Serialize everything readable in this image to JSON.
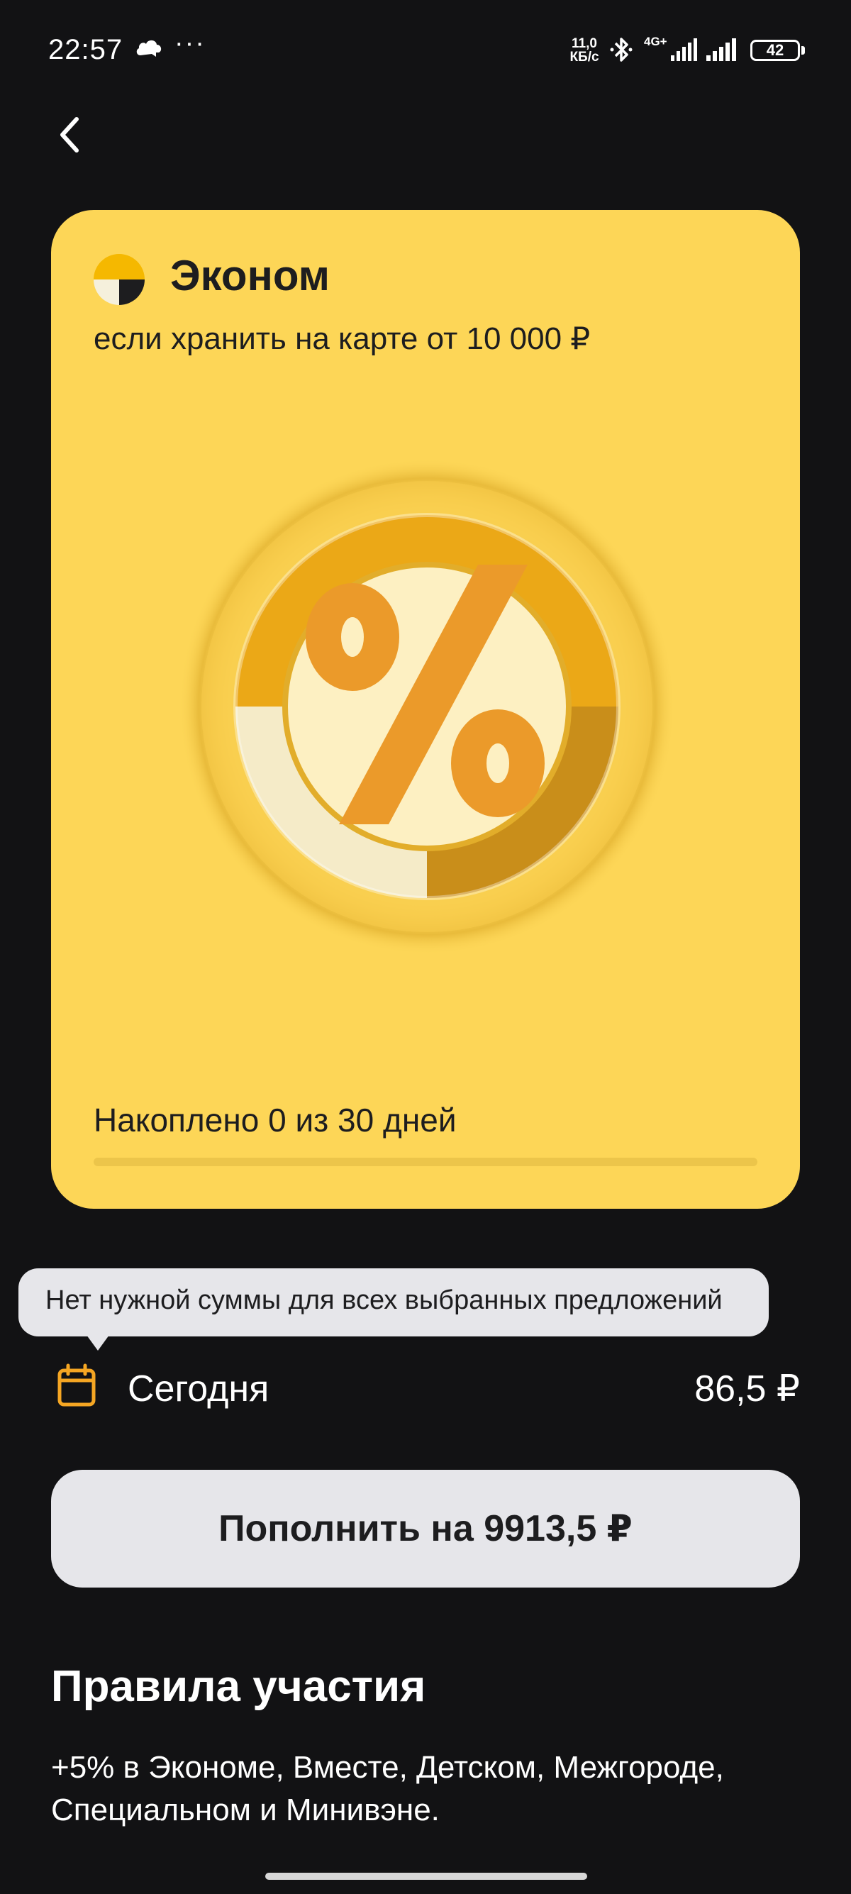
{
  "status_bar": {
    "time": "22:57",
    "more": "···",
    "speed_value": "11,0",
    "speed_unit": "КБ/с",
    "network": "4G+",
    "battery": "42"
  },
  "offer": {
    "title": "Эконом",
    "subtitle": "если хранить на карте от 10 000 ₽",
    "progress_label": "Накоплено 0 из 30 дней",
    "progress_days": 0,
    "progress_total_days": 30
  },
  "tooltip": {
    "text": "Нет нужной суммы для всех выбранных предложений"
  },
  "today": {
    "label": "Сегодня",
    "amount": "86,5 ₽"
  },
  "topup_button": {
    "label": "Пополнить на 9913,5 ₽"
  },
  "rules": {
    "title": "Правила участия",
    "text": "+5% в Экономе, Вместе, Детском, Межгороде, Специальном и Минивэне."
  },
  "colors": {
    "background": "#121214",
    "card": "#fdd657",
    "accent": "#f5a623",
    "button": "#e6e6ea"
  },
  "icons": [
    "cloud-icon",
    "more-icon",
    "bluetooth-icon",
    "signal-icon",
    "battery-icon",
    "back-icon",
    "yandex-go-logo-icon",
    "percent-badge-icon",
    "calendar-icon"
  ]
}
